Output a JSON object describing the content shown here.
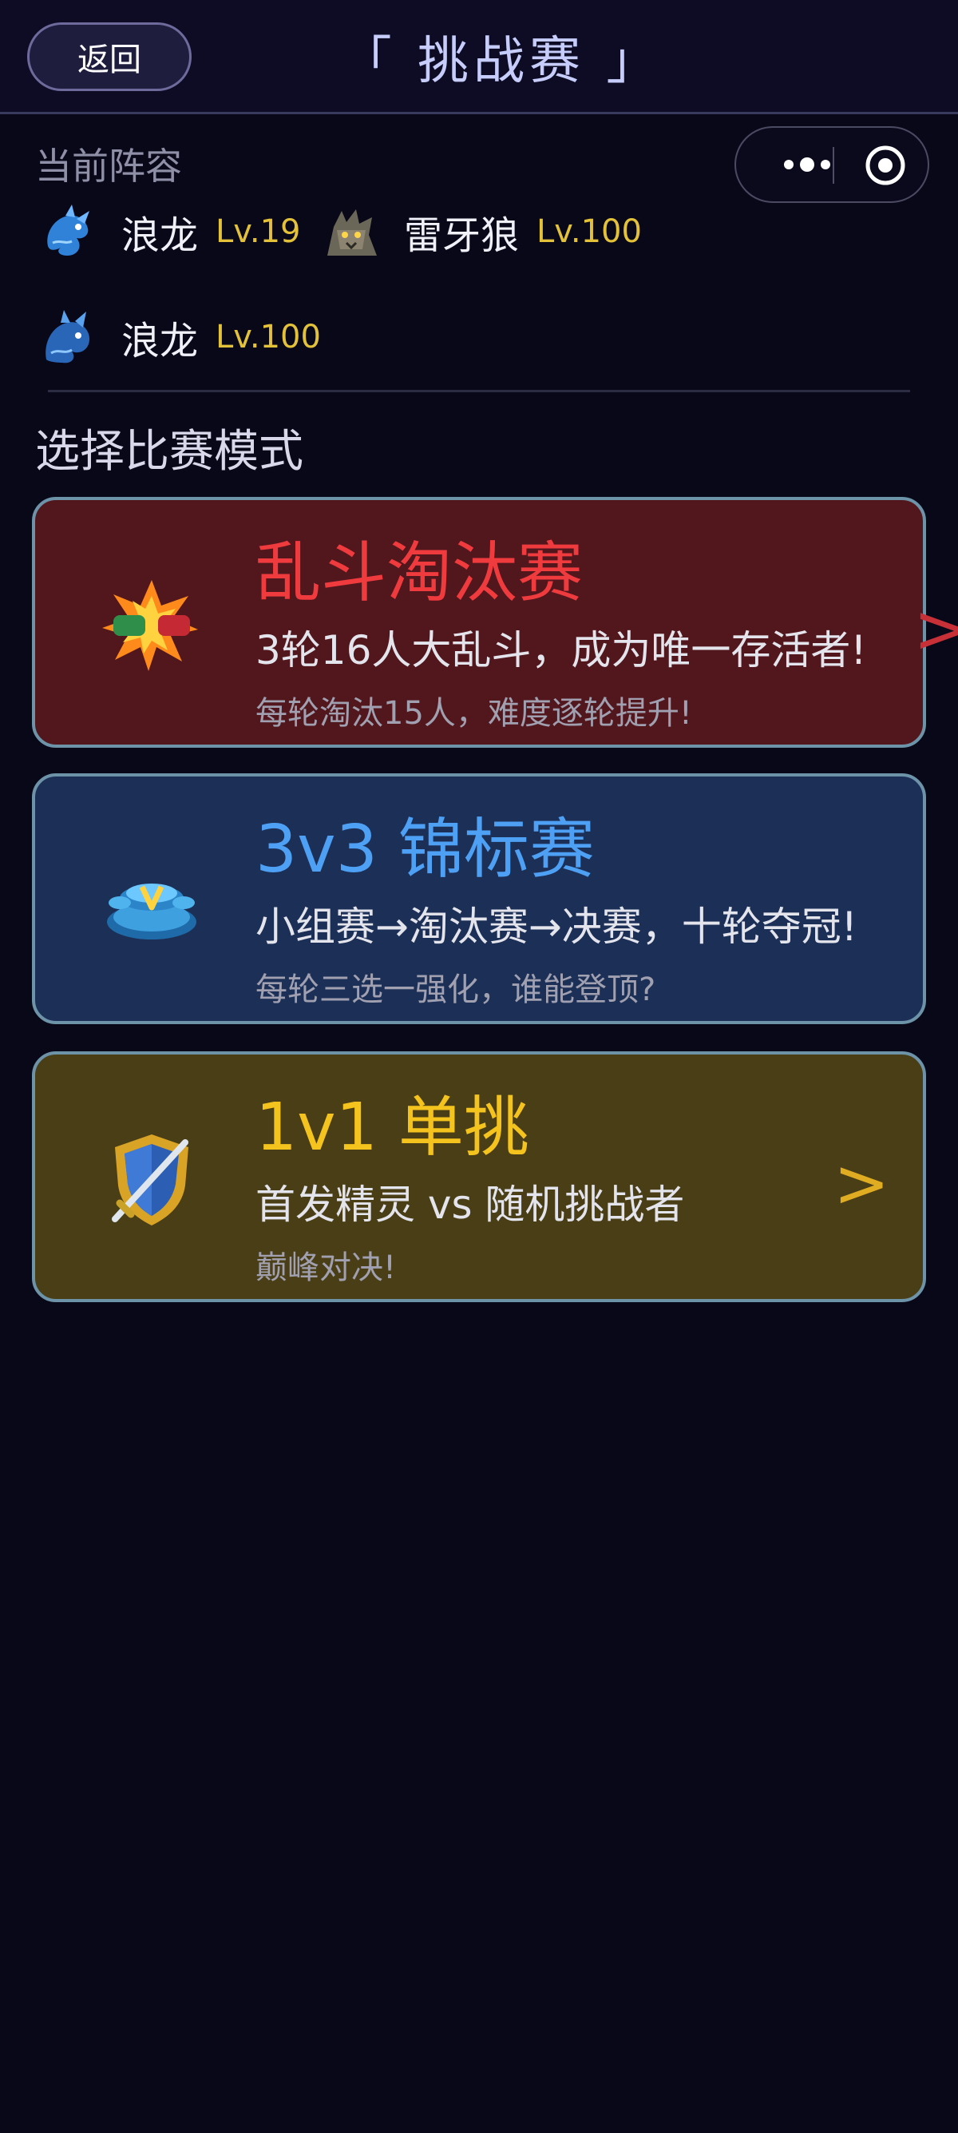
{
  "header": {
    "back_label": "返回",
    "title": "「 挑战赛 」"
  },
  "lineup": {
    "title": "当前阵容",
    "members": [
      {
        "name": "浪龙",
        "level": "Lv.19",
        "icon": "blue-dragon-icon"
      },
      {
        "name": "雷牙狼",
        "level": "Lv.100",
        "icon": "thunder-wolf-icon"
      },
      {
        "name": "浪龙",
        "level": "Lv.100",
        "icon": "blue-dragon-icon"
      }
    ]
  },
  "mode_title": "选择比赛模式",
  "modes": [
    {
      "name": "乱斗淘汰赛",
      "desc": "3轮16人大乱斗，成为唯一存活者!",
      "sub": "每轮淘汰15人，难度逐轮提升!",
      "chevron": ">",
      "icon": "brawl-explosion-icon",
      "color": "#ef3a3e"
    },
    {
      "name": "3v3 锦标赛",
      "desc": "小组赛→淘汰赛→决赛，十轮夺冠!",
      "sub": "每轮三选一强化，谁能登顶?",
      "icon": "tournament-arena-icon",
      "color": "#4ea0f4"
    },
    {
      "name": "1v1 单挑",
      "desc": "首发精灵 vs 随机挑战者",
      "sub": "巅峰对决!",
      "chevron": ">",
      "icon": "shield-sword-icon",
      "color": "#f5c31d"
    }
  ]
}
